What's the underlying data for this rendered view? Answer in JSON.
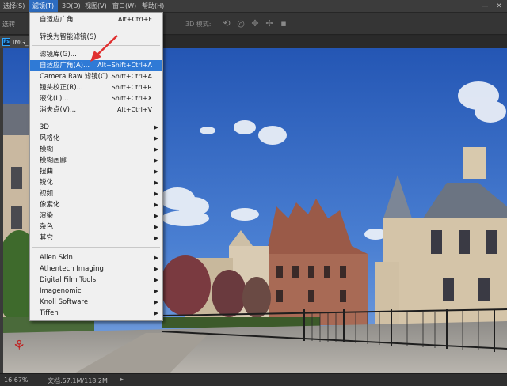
{
  "menubar": {
    "items": [
      {
        "label": "选择(S)",
        "active": false
      },
      {
        "label": "滤镜(T)",
        "active": true
      },
      {
        "label": "3D(D)",
        "active": false
      },
      {
        "label": "视图(V)",
        "active": false
      },
      {
        "label": "窗口(W)",
        "active": false
      },
      {
        "label": "帮助(H)",
        "active": false
      }
    ],
    "minimize": "—",
    "close": "✕"
  },
  "options": {
    "left_label": "选转",
    "mode_label": "3D 模式:"
  },
  "document": {
    "tab_label": "IMG_",
    "ps_badge": "Ps"
  },
  "status": {
    "zoom": "16.67%",
    "doc_size": "文档:57.1M/118.2M",
    "arrow": "▸"
  },
  "filter_menu": {
    "items": [
      {
        "label": "自适应广角",
        "shortcut": "Alt+Ctrl+F",
        "submenu": false,
        "highlight": false
      },
      {
        "label": "转换为智能滤镜(S)",
        "shortcut": "",
        "submenu": false,
        "highlight": false
      },
      {
        "label": "滤镜库(G)...",
        "shortcut": "",
        "submenu": false,
        "highlight": false
      },
      {
        "label": "自适应广角(A)...",
        "shortcut": "Alt+Shift+Ctrl+A",
        "submenu": false,
        "highlight": true
      },
      {
        "label": "Camera Raw 滤镜(C)...",
        "shortcut": "Shift+Ctrl+A",
        "submenu": false,
        "highlight": false
      },
      {
        "label": "镜头校正(R)...",
        "shortcut": "Shift+Ctrl+R",
        "submenu": false,
        "highlight": false
      },
      {
        "label": "液化(L)...",
        "shortcut": "Shift+Ctrl+X",
        "submenu": false,
        "highlight": false
      },
      {
        "label": "消失点(V)...",
        "shortcut": "Alt+Ctrl+V",
        "submenu": false,
        "highlight": false
      },
      {
        "label": "3D",
        "shortcut": "",
        "submenu": true,
        "highlight": false
      },
      {
        "label": "风格化",
        "shortcut": "",
        "submenu": true,
        "highlight": false
      },
      {
        "label": "模糊",
        "shortcut": "",
        "submenu": true,
        "highlight": false
      },
      {
        "label": "模糊画廊",
        "shortcut": "",
        "submenu": true,
        "highlight": false
      },
      {
        "label": "扭曲",
        "shortcut": "",
        "submenu": true,
        "highlight": false
      },
      {
        "label": "锐化",
        "shortcut": "",
        "submenu": true,
        "highlight": false
      },
      {
        "label": "视频",
        "shortcut": "",
        "submenu": true,
        "highlight": false
      },
      {
        "label": "像素化",
        "shortcut": "",
        "submenu": true,
        "highlight": false
      },
      {
        "label": "渲染",
        "shortcut": "",
        "submenu": true,
        "highlight": false
      },
      {
        "label": "杂色",
        "shortcut": "",
        "submenu": true,
        "highlight": false
      },
      {
        "label": "其它",
        "shortcut": "",
        "submenu": true,
        "highlight": false
      },
      {
        "label": "Alien Skin",
        "shortcut": "",
        "submenu": true,
        "highlight": false
      },
      {
        "label": "Athentech Imaging",
        "shortcut": "",
        "submenu": true,
        "highlight": false
      },
      {
        "label": "Digital Film Tools",
        "shortcut": "",
        "submenu": true,
        "highlight": false
      },
      {
        "label": "Imagenomic",
        "shortcut": "",
        "submenu": true,
        "highlight": false
      },
      {
        "label": "Knoll Software",
        "shortcut": "",
        "submenu": true,
        "highlight": false
      },
      {
        "label": "Tiffen",
        "shortcut": "",
        "submenu": true,
        "highlight": false
      }
    ]
  },
  "colors": {
    "accent": "#2f7ad6",
    "menu_bg": "#f0f0f0",
    "annotation": "#e03030"
  }
}
